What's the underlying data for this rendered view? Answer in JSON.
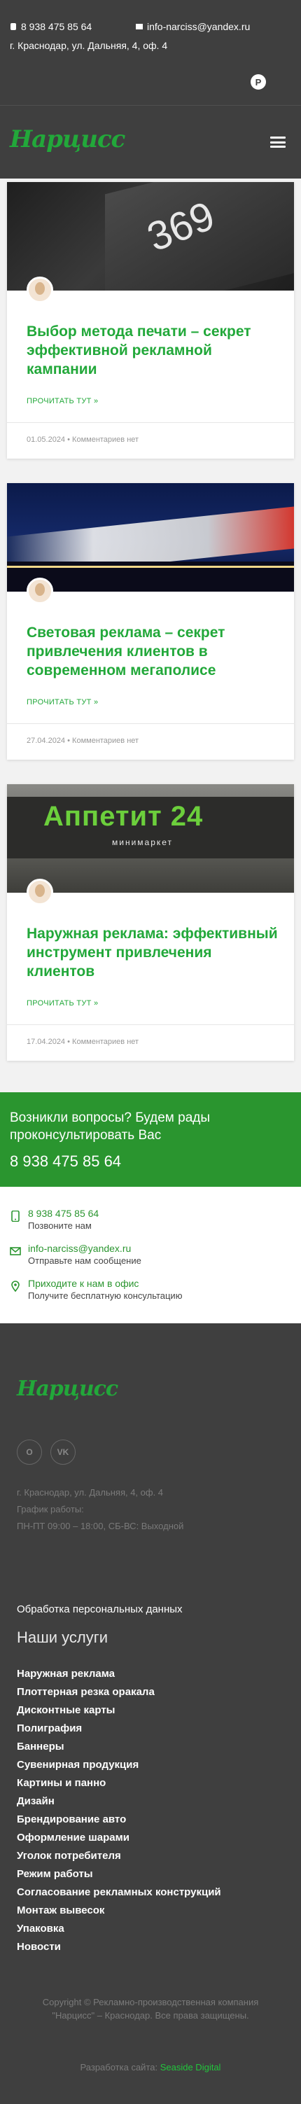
{
  "topbar": {
    "phone": "8 938 475 85 64",
    "email": "info-narciss@yandex.ru",
    "address": "г. Краснодар, ул. Дальняя, 4, оф. 4",
    "social_icon": "pinterest-icon"
  },
  "header": {
    "logo": "Нарцисс",
    "menu_icon": "hamburger-menu-icon"
  },
  "posts": [
    {
      "title": "Выбор метода печати – секрет эффективной рекламной кампании",
      "image_text": "369",
      "more": "ПРОЧИТАТЬ ТУТ »",
      "date": "01.05.2024",
      "comments": "Комментариев нет"
    },
    {
      "title": "Световая реклама – секрет привлечения клиентов в современном мегаполисе",
      "image_text": "",
      "more": "ПРОЧИТАТЬ ТУТ »",
      "date": "27.04.2024",
      "comments": "Комментариев нет"
    },
    {
      "title": "Наружная реклама: эффективный инструмент привлечения клиентов",
      "image_text": "Аппетит 24",
      "image_subtext": "минимаркет",
      "more": "ПРОЧИТАТЬ ТУТ »",
      "date": "17.04.2024",
      "comments": "Комментариев нет"
    }
  ],
  "contact": {
    "question": "Возникли вопросы? Будем рады проконсультировать Вас",
    "phone_big": "8 938 475 85 64",
    "rows": [
      {
        "line1": "8 938 475 85 64",
        "line2": "Позвоните нам"
      },
      {
        "line1": "info-narciss@yandex.ru",
        "line2": "Отправьте нам сообщение"
      },
      {
        "line1": "Приходите к нам в офис",
        "line2": "Получите бесплатную консультацию"
      }
    ]
  },
  "footer": {
    "logo": "Нарцисс",
    "social": [
      "О",
      "VK"
    ],
    "address": "г. Краснодар, ул. Дальняя, 4, оф. 4",
    "schedule_label": "График работы:",
    "schedule": "ПН-ПТ 09:00 – 18:00, СБ-ВС: Выходной",
    "privacy": "Обработка персональных данных",
    "services_heading": "Наши услуги",
    "services": [
      "Наружная реклама",
      "Плоттерная резка оракала",
      "Дисконтные карты",
      "Полиграфия",
      "Баннеры",
      "Сувенирная продукция",
      "Картины и панно",
      "Дизайн",
      "Брендирование авто",
      "Оформление шарами",
      "Уголок потребителя",
      "Режим работы",
      "Согласование рекламных конструкций",
      "Монтаж вывесок",
      "Упаковка",
      "Новости"
    ],
    "copyright": "Copyright © Рекламно-производственная компания \"Нарцисс\" – Краснодар. Все права защищены.",
    "dev_label": "Разработка сайта:",
    "dev_name": "Seaside Digital"
  },
  "colors": {
    "accent": "#22a83a",
    "dark": "#3f3f3f",
    "contact_bg": "#2a952f"
  }
}
